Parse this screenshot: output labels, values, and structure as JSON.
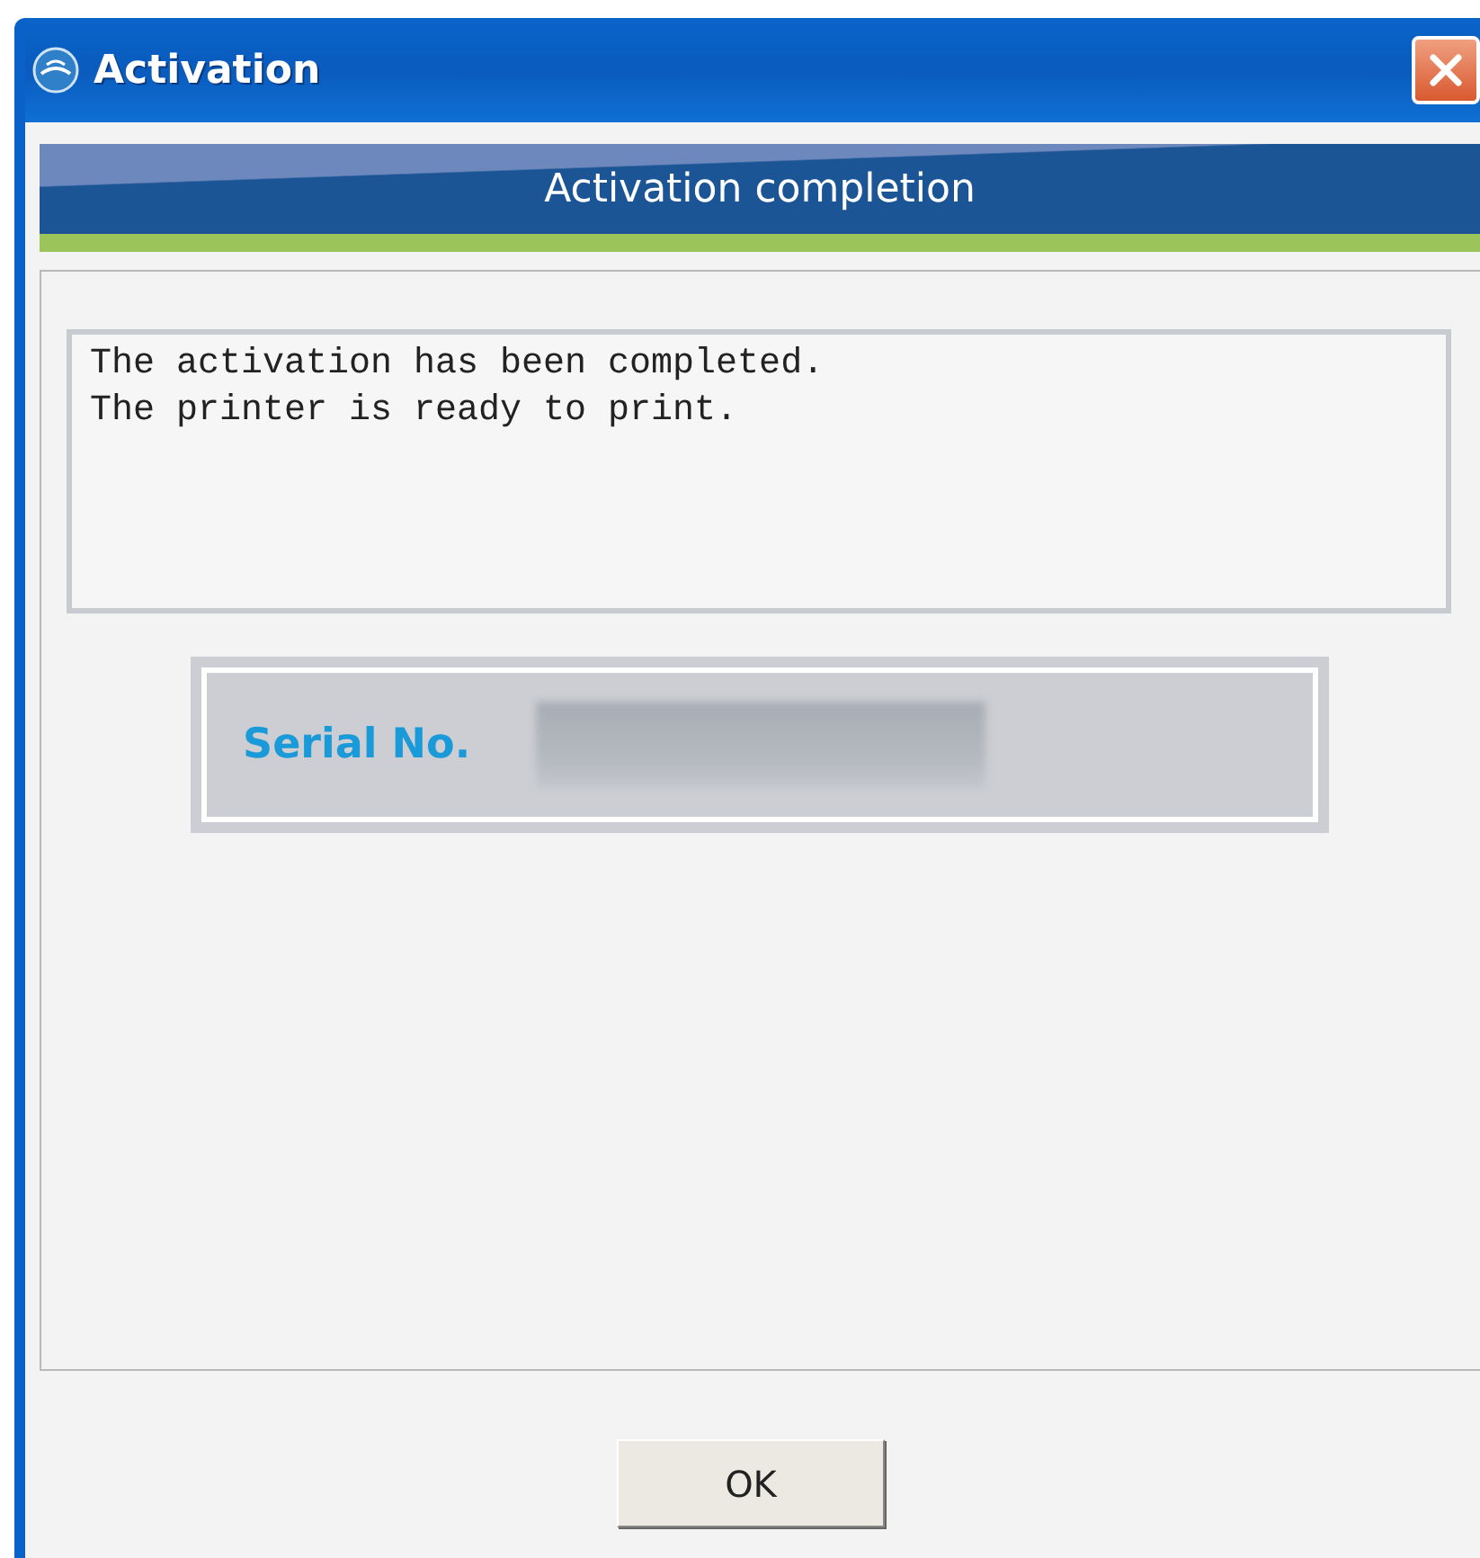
{
  "window": {
    "title": "Activation"
  },
  "header": {
    "title": "Activation completion"
  },
  "message_lines": [
    "The activation has been completed.",
    "The printer is ready to print."
  ],
  "serial": {
    "label": "Serial No.",
    "value_redacted": true
  },
  "buttons": [
    "OK"
  ]
}
